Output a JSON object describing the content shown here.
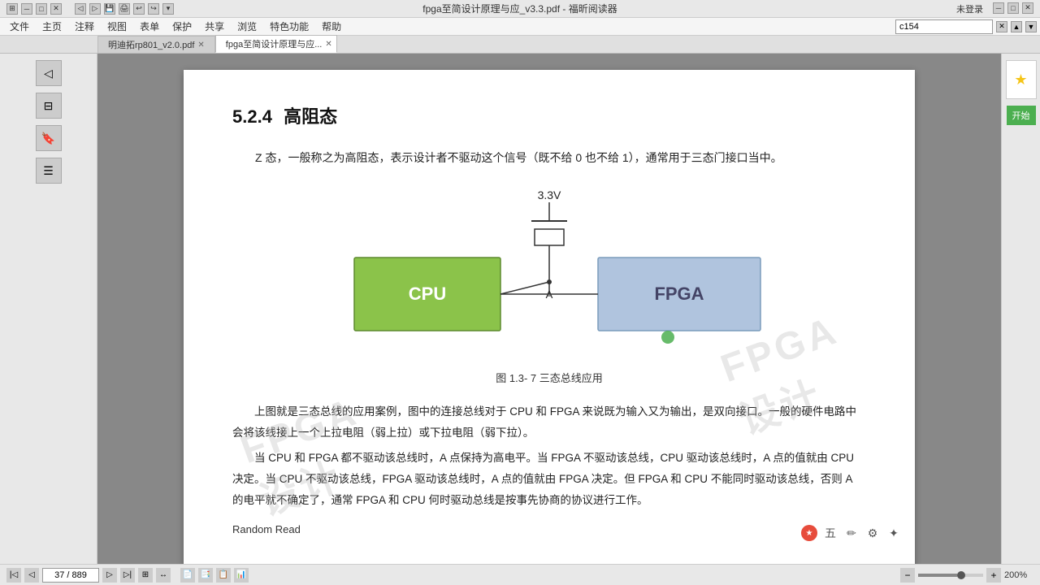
{
  "window": {
    "title": "fpga至简设计原理与应_v3.3.pdf - 福昕阅读器",
    "user": "未登录"
  },
  "menu": {
    "items": [
      "文件",
      "主页",
      "注释",
      "视图",
      "表单",
      "保护",
      "共享",
      "浏览",
      "特色功能",
      "帮助"
    ]
  },
  "tabs": [
    {
      "label": "明迪拓rp801_v2.0.pdf",
      "active": false
    },
    {
      "label": "fpga至简设计原理与应...",
      "active": true
    }
  ],
  "toolbar": {
    "search_placeholder": "c154",
    "search_value": "c154"
  },
  "content": {
    "section_number": "5.2.4",
    "section_title": "高阻态",
    "para1": "Z 态，一般称之为高阻态，表示设计者不驱动这个信号（既不给 0 也不给 1），通常用于三态门接口当中。",
    "diagram_caption": "图 1.3- 7 三态总线应用",
    "voltage_label": "3.3V",
    "node_label": "A",
    "cpu_label": "CPU",
    "fpga_label": "FPGA",
    "para2": "上图就是三态总线的应用案例，图中的连接总线对于 CPU 和 FPGA 来说既为输入又为输出，是双向接口。一般的硬件电路中会将该线接上一个上拉电阻（弱上拉）或下拉电阻（弱下拉）。",
    "para3": "当 CPU 和 FPGA 都不驱动该总线时，A 点保持为高电平。当 FPGA 不驱动该总线，CPU 驱动该总线时，A 点的值就由 CPU 决定。当 CPU 不驱动该总线，FPGA 驱动该总线时，A 点的值就由 FPGA 决定。但 FPGA 和 CPU 不能同时驱动该总线，否则 A 的电平就不确定了，通常 FPGA 和 CPU 何时驱动总线是按事先协商的协议进行工作。",
    "random_read": "Random Read"
  },
  "status_bar": {
    "page_current": "37",
    "page_total": "889",
    "zoom": "200%",
    "view_icons": [
      "📄",
      "📑",
      "🖼",
      "📊"
    ]
  }
}
